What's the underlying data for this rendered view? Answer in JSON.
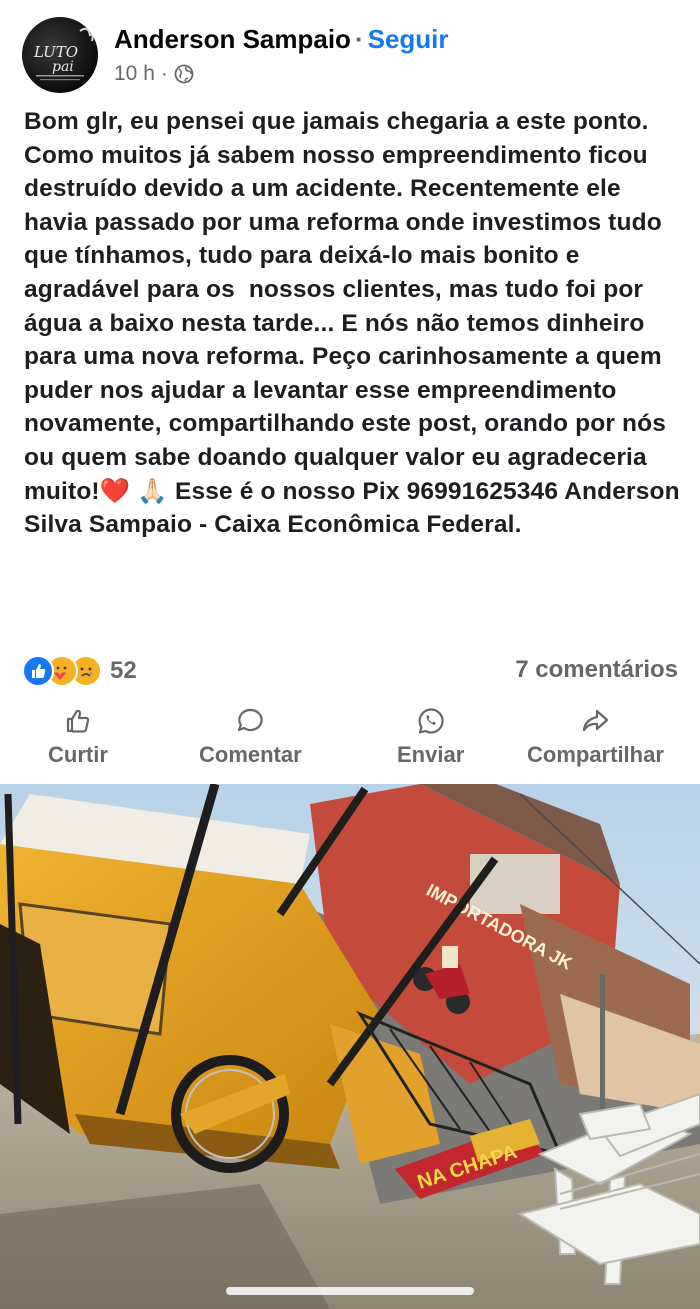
{
  "post": {
    "author": "Anderson Sampaio",
    "separator": "·",
    "follow_label": "Seguir",
    "time": "10 h",
    "time_separator": "·",
    "audience_icon": "globe-icon",
    "avatar_text": "LUTO pai",
    "text": "Bom glr, eu pensei que jamais chegaria a este ponto. Como muitos já sabem nosso empreendimento ficou destruído devido a um acidente. Recentemente ele havia passado por uma reforma onde investimos tudo que tínhamos, tudo para deixá-lo mais bonito e agradável para os  nossos clientes, mas tudo foi por água a baixo nesta tarde... E nós não temos dinheiro para uma nova reforma. Peço carinhosamente a quem puder nos ajudar a levantar esse empreendimento novamente, compartilhando este post, orando por nós ou quem sabe doando qualquer valor eu agradeceria muito!❤️ 🙏🏻 Esse é o nosso Pix 96991625346 Anderson Silva Sampaio - Caixa Econômica Federal."
  },
  "stats": {
    "reaction_icons": [
      "like-reaction-icon",
      "care-reaction-icon",
      "sad-reaction-icon"
    ],
    "reaction_count": "52",
    "comments_label": "7 comentários"
  },
  "actions": [
    {
      "icon": "thumbs-up-icon",
      "label": "Curtir"
    },
    {
      "icon": "comment-bubble-icon",
      "label": "Comentar"
    },
    {
      "icon": "whatsapp-icon",
      "label": "Enviar"
    },
    {
      "icon": "share-arrow-icon",
      "label": "Compartilhar"
    }
  ],
  "photo": {
    "sign_text": "NA CHAPA",
    "store_text": "IMPORTADORA JK"
  },
  "colors": {
    "link_blue": "#1877f2",
    "secondary_text": "#65676b",
    "kiosk_yellow": "#e8a21a"
  }
}
